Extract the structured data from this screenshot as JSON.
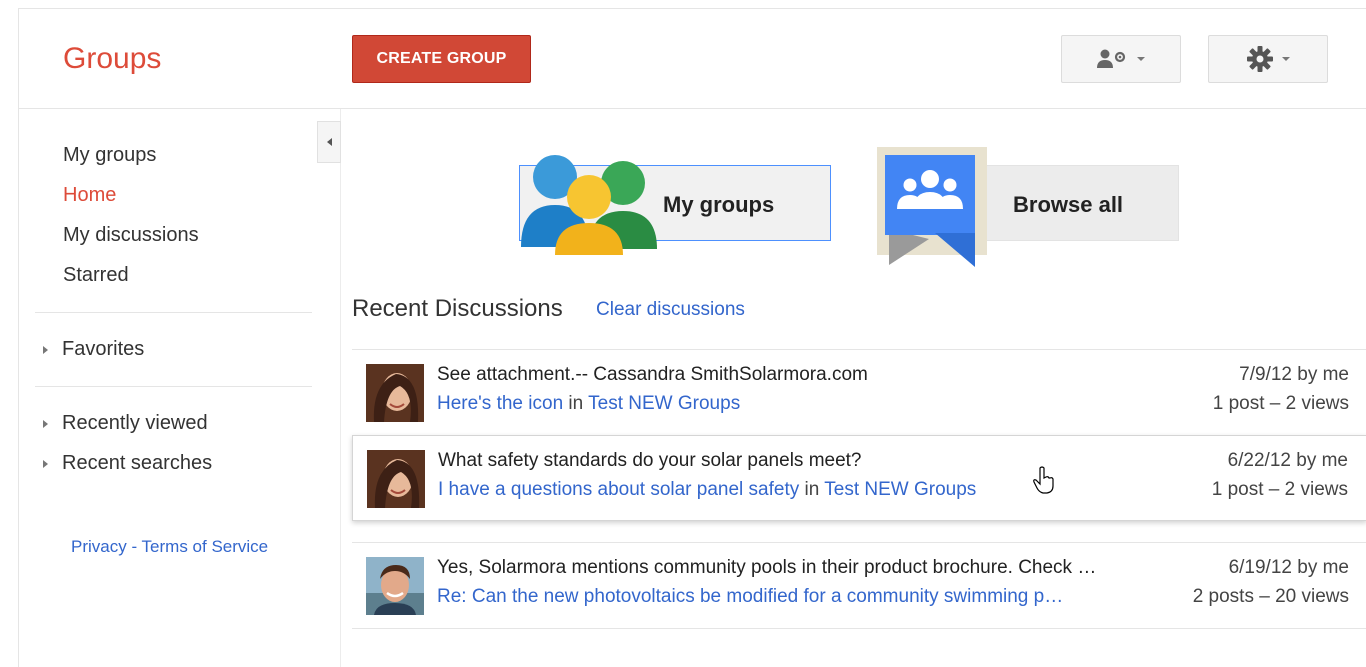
{
  "header": {
    "brand": "Groups",
    "create_button": "CREATE GROUP"
  },
  "sidebar": {
    "nav": [
      "My groups",
      "Home",
      "My discussions",
      "Starred"
    ],
    "favorites": "Favorites",
    "recently_viewed": "Recently viewed",
    "recent_searches": "Recent searches",
    "privacy": "Privacy",
    "separator": " - ",
    "terms": "Terms of Service"
  },
  "tiles": {
    "my_groups": "My groups",
    "browse_all": "Browse all"
  },
  "recent": {
    "title": "Recent Discussions",
    "clear": "Clear discussions"
  },
  "discussions": [
    {
      "snippet": "See attachment.-- Cassandra SmithSolarmora.com",
      "subject": "Here's the icon",
      "in": "in",
      "group": "Test NEW Groups",
      "date": "7/9/12 by me",
      "stats": "1 post – 2 views"
    },
    {
      "snippet": "What safety standards do your solar panels meet?",
      "subject": "I have a questions about solar panel safety",
      "in": "in",
      "group": "Test NEW Groups",
      "date": "6/22/12 by me",
      "stats": "1 post – 2 views"
    },
    {
      "snippet": "Yes, Solarmora mentions community pools in their product brochure. Check …",
      "subject": "Re: Can the new photovoltaics be modified for a community swimming p…",
      "in": "",
      "group": "",
      "date": "6/19/12 by me",
      "stats": "2 posts – 20 views"
    }
  ],
  "colors": {
    "brand_red": "#dd4b39",
    "create_button": "#d14836",
    "link_blue": "#3366cc"
  },
  "icons": [
    "admin-person-gear-icon",
    "settings-gear-icon",
    "my-groups-people-icon",
    "browse-all-groups-icon"
  ]
}
